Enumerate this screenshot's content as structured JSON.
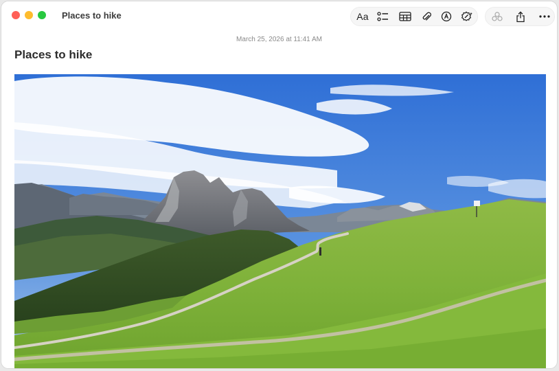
{
  "window": {
    "title": "Places to hike"
  },
  "toolbar": {
    "format_label": "Aa",
    "format_group": [
      "text-format",
      "checklist",
      "table",
      "attachment",
      "markup",
      "writing-tools"
    ],
    "share_group": [
      "collaborate",
      "share",
      "more"
    ]
  },
  "note": {
    "date": "March 25, 2026 at 11:41 AM",
    "title": "Places to hike",
    "attachment": {
      "type": "photo",
      "subject": "green alpine meadow with a dirt hiking trail below rocky mountain peaks and a blue sky with clouds"
    }
  },
  "colors": {
    "close": "#ff5f57",
    "minimize": "#febc2e",
    "maximize": "#28c840",
    "sky": "#3f7fdc",
    "meadow": "#7fb23a"
  }
}
